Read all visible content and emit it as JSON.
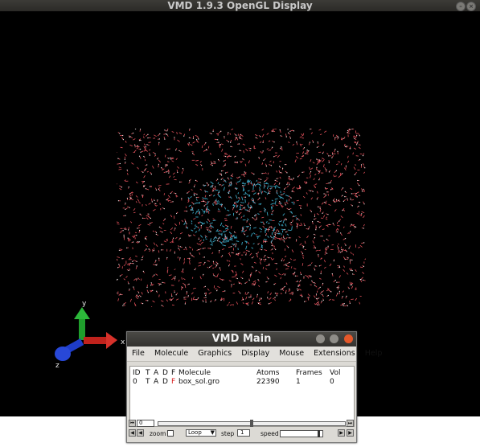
{
  "gl_window": {
    "title": "VMD 1.9.3 OpenGL Display",
    "axes": {
      "x": "x",
      "y": "y",
      "z": "z"
    }
  },
  "vmd_main": {
    "title": "VMD Main",
    "menus": [
      "File",
      "Molecule",
      "Graphics",
      "Display",
      "Mouse",
      "Extensions",
      "Help"
    ],
    "columns": {
      "id": "ID",
      "t": "T",
      "a": "A",
      "d": "D",
      "f": "F",
      "molecule": "Molecule",
      "atoms": "Atoms",
      "frames": "Frames",
      "vol": "Vol"
    },
    "rows": [
      {
        "id": "0",
        "t": "T",
        "a": "A",
        "d": "D",
        "f": "F",
        "molecule": "box_sol.gro",
        "atoms": "22390",
        "frames": "1",
        "vol": "0"
      }
    ],
    "animation": {
      "frame": "0",
      "zoom_label": "zoom",
      "loop_mode": "Loop",
      "step_label": "step",
      "step_value": "1",
      "speed_label": "speed"
    }
  },
  "colors": {
    "background": "#000000",
    "water_oxygen": "#e0505a",
    "water_hydrogen": "#e8e8e8",
    "protein": "#3aa7c4",
    "x_axis": "#c0221c",
    "y_axis": "#1f9e2c",
    "z_axis": "#1e3cc8",
    "mol_f_flag": "#d81b1b"
  }
}
